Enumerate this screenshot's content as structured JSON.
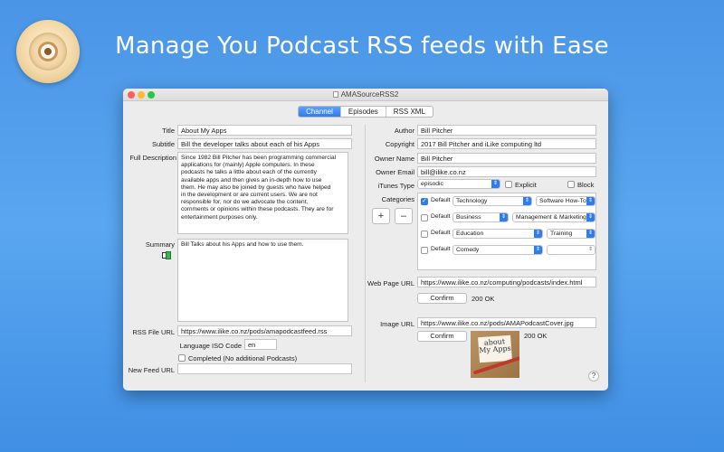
{
  "headline": "Manage You Podcast RSS feeds with Ease",
  "window": {
    "title": "AMASourceRSS2"
  },
  "tabs": [
    "Channel",
    "Episodes",
    "RSS XML"
  ],
  "left": {
    "title_label": "Title",
    "title_value": "About My Apps",
    "subtitle_label": "Subtitle",
    "subtitle_value": "Bill the developer talks about each of his Apps",
    "description_label": "Full Description",
    "description_value": "Since 1982 Bill Pitcher has been programming commercial\napplications for (mainly) Apple computers. In these\npodcasts he talks a little about each of the currently\navailable apps and then gives an in-depth how to use\nthem. He may also be joined by guests who have helped\nin the development or are current users. We are not\nresponsible for, nor do we advocate the content,\ncomments or opinions within these podcasts. They are for\nentertainment purposes only.",
    "summary_label": "Summary",
    "summary_value": "Bill Talks about his Apps and how to use them.",
    "rss_label": "RSS File URL",
    "rss_value": "https://www.ilike.co.nz/pods/amapodcastfeed.rss",
    "language_label": "Language ISO Code",
    "language_value": "en",
    "completed_label": "Completed (No additional Podcasts)",
    "newfeed_label": "New Feed URL",
    "newfeed_value": ""
  },
  "right": {
    "author_label": "Author",
    "author_value": "Bill Pitcher",
    "copyright_label": "Copyright",
    "copyright_value": "2017 Bill Pitcher and iLike computing ltd",
    "owner_name_label": "Owner Name",
    "owner_name_value": "Bill Pitcher",
    "owner_email_label": "Owner Email",
    "owner_email_value": "bill@ilike.co.nz",
    "itunes_type_label": "iTunes Type",
    "itunes_type_value": "episodic",
    "explicit_label": "Explicit",
    "block_label": "Block",
    "categories_label": "Categories",
    "plus_label": "+",
    "minus_label": "–",
    "categories": [
      {
        "default_label": "Default",
        "checked": true,
        "main": "Technology",
        "sub": "Software How-To"
      },
      {
        "default_label": "Default",
        "checked": false,
        "main": "Business",
        "sub": "Management & Marketing"
      },
      {
        "default_label": "Default",
        "checked": false,
        "main": "Education",
        "sub": "Training"
      },
      {
        "default_label": "Default",
        "checked": false,
        "main": "Comedy",
        "sub": ""
      }
    ],
    "webpage_label": "Web Page URL",
    "webpage_value": "https://www.ilike.co.nz/computing/podcasts/index.html",
    "webpage_confirm": "Confirm",
    "webpage_status": "200 OK",
    "image_label": "Image URL",
    "image_value": "https://www.ilike.co.nz/pods/AMAPodcastCover.jpg",
    "image_confirm": "Confirm",
    "image_status": "200 OK",
    "cover_text": "about\nMy Apps"
  },
  "help_label": "?",
  "colors": {
    "background": "#4a95e6",
    "accent": "#2f7cf0",
    "window": "#ececec"
  }
}
